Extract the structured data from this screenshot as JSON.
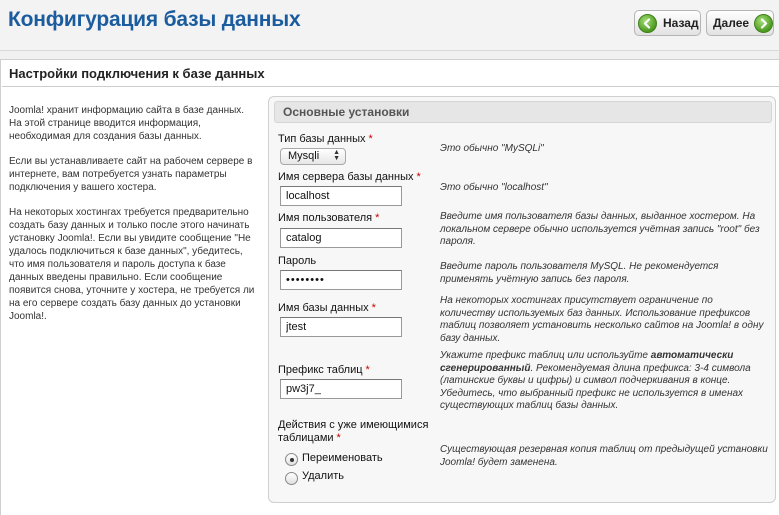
{
  "header": {
    "title": "Конфигурация базы данных",
    "back_label": "Назад",
    "next_label": "Далее"
  },
  "section": {
    "title": "Настройки подключения к базе данных"
  },
  "intro": [
    "Joomla! хранит информацию сайта в базе данных. На этой странице вводится информация, необходимая для создания базы данных.",
    "Если вы устанавливаете сайт на рабочем сервере в интернете, вам потребуется узнать параметры подключения у вашего хостера.",
    "На некоторых хостингах требуется предварительно создать базу данных и только после этого начинать установку Joomla!. Если вы увидите сообщение \"Не удалось подключиться к базе данных\", убедитесь, что имя пользователя и пароль доступа к базе данных введены правильно. Если сообщение появится снова, уточните у хостера, не требуется ли на его сервере создать базу данных до установки Joomla!."
  ],
  "form": {
    "legend": "Основные установки",
    "required_mark": "*",
    "db_type": {
      "label": "Тип базы данных",
      "value": "Mysqli",
      "hint": "Это обычно \"MySQLi\""
    },
    "host": {
      "label": "Имя сервера базы данных",
      "value": "localhost",
      "hint": "Это обычно \"localhost\""
    },
    "user": {
      "label": "Имя пользователя",
      "value": "catalog",
      "hint": "Введите имя пользователя базы данных, выданное хостером. На локальном сервере обычно используется учётная запись \"root\" без пароля."
    },
    "password": {
      "label": "Пароль",
      "value": "••••••••",
      "hint": "Введите пароль пользователя MySQL. Не рекомендуется применять учётную запись без пароля."
    },
    "db_name": {
      "label": "Имя базы данных",
      "value": "jtest",
      "hint": "На некоторых хостингах присутствует ограничение по количеству используемых баз данных. Использование префиксов таблиц позволяет установить несколько сайтов на Joomla! в одну базу данных."
    },
    "prefix": {
      "label": "Префикс таблиц",
      "value": "pw3j7_",
      "hint_before": "Укажите префикс таблиц или используйте ",
      "hint_bold": "автоматически сгенерированный",
      "hint_after": ". Рекомендуемая длина префикса: 3-4 символа (латинские буквы и цифры) и символ подчеркивания в конце. Убедитесь, что выбранный префикс не используется в именах существующих таблиц базы данных."
    },
    "existing": {
      "label_line1": "Действия с уже имеющимися",
      "label_line2": "таблицами",
      "hint": "Существующая резервная копия таблиц от предыдущей установки Joomla! будет заменена.",
      "options": [
        "Переименовать",
        "Удалить"
      ],
      "selected": "Переименовать"
    }
  },
  "colors": {
    "title_blue": "#1b5c9e",
    "required_red": "#cc0000",
    "button_green": "#4c9a20"
  },
  "icons": {
    "back": "arrow-left-icon",
    "next": "arrow-right-icon"
  }
}
